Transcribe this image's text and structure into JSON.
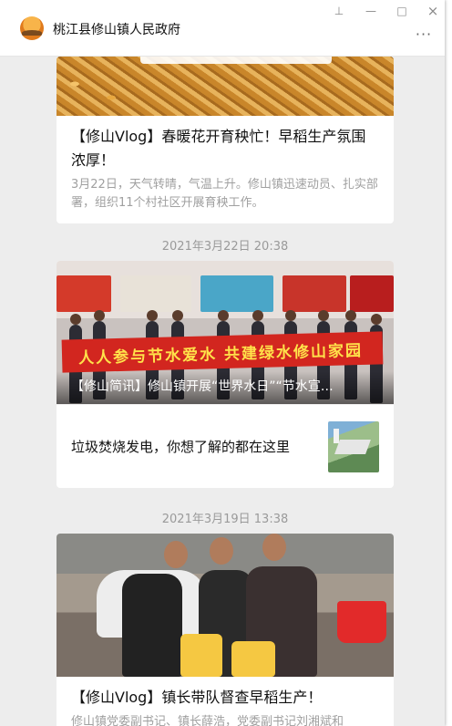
{
  "window": {
    "account_name": "桃江县修山镇人民政府",
    "controls": {
      "pin": "⊥",
      "minimize": "—",
      "maximize": "□",
      "close": "×"
    },
    "more": "···"
  },
  "feed": {
    "card1": {
      "title": "【修山Vlog】春暖花开育秧忙！早稻生产氛围浓厚！",
      "desc": "3月22日，天气转晴，气温上升。修山镇迅速动员、扎实部署，组织11个村社区开展育秧工作。"
    },
    "ts1": "2021年3月22日 20:38",
    "card2": {
      "banner": "人人参与节水爱水 共建绿水修山家园",
      "overlay_title": "【修山简讯】修山镇开展“世界水日”“节水宣…",
      "sub_title": "垃圾焚烧发电，你想了解的都在这里"
    },
    "ts2": "2021年3月19日 13:38",
    "card3": {
      "title": "【修山Vlog】镇长带队督查早稻生产！",
      "desc": "修山镇党委副书记、镇长薛浩，党委副书记刘湘斌和"
    }
  }
}
